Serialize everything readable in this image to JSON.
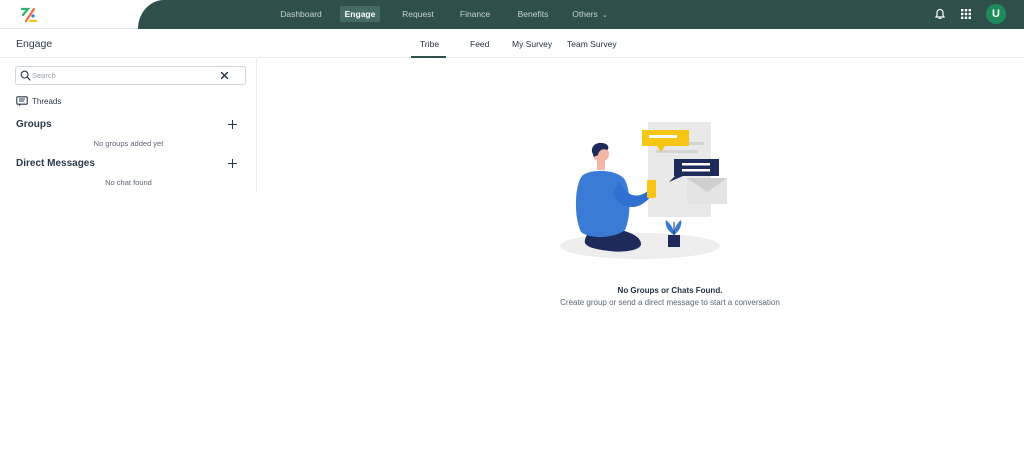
{
  "nav": {
    "items": [
      {
        "label": "Dashboard"
      },
      {
        "label": "Engage"
      },
      {
        "label": "Request"
      },
      {
        "label": "Finance"
      },
      {
        "label": "Benefits"
      },
      {
        "label": "Others"
      }
    ],
    "active": "Engage",
    "avatar_initial": "U"
  },
  "header": {
    "title": "Engage",
    "tabs": [
      {
        "label": "Tribe"
      },
      {
        "label": "Feed"
      },
      {
        "label": "My Survey"
      },
      {
        "label": "Team Survey"
      }
    ],
    "active_tab": "Tribe"
  },
  "sidebar": {
    "search_placeholder": "Search",
    "threads_label": "Threads",
    "groups_title": "Groups",
    "groups_empty": "No groups added yet",
    "dm_title": "Direct Messages",
    "dm_empty": "No chat found"
  },
  "empty_state": {
    "title": "No Groups or Chats Found.",
    "description": "Create group or send a direct message to start a conversation"
  },
  "colors": {
    "nav_bg": "#2f4f4a",
    "nav_active_bg": "#466a64",
    "avatar_bg": "#1f8a5b",
    "illustration_blue": "#3a7bd5",
    "illustration_navy": "#1e2a5a",
    "illustration_yellow": "#f6c515"
  },
  "icons": [
    "logo-icon",
    "bell-icon",
    "apps-grid-icon",
    "search-icon",
    "close-icon",
    "threads-icon",
    "plus-icon",
    "chevron-down-icon"
  ]
}
